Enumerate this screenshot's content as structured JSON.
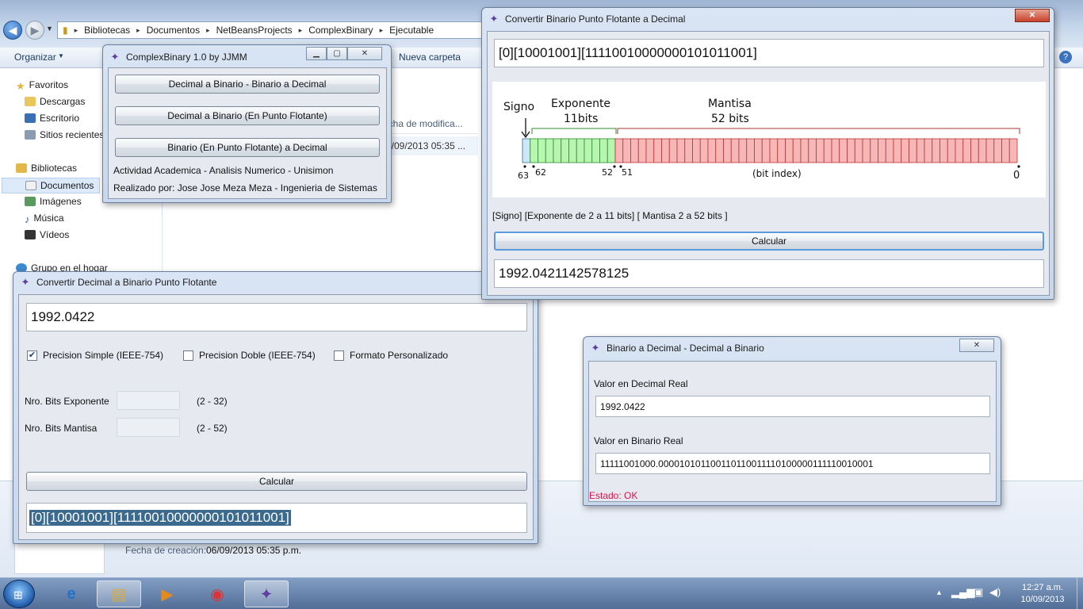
{
  "explorer": {
    "breadcrumb": [
      "Bibliotecas",
      "Documentos",
      "NetBeansProjects",
      "ComplexBinary",
      "Ejecutable"
    ],
    "cmd_organize": "Organizar",
    "cmd_new_folder": "Nueva carpeta",
    "nav": {
      "favoritos": "Favoritos",
      "descargas": "Descargas",
      "escritorio": "Escritorio",
      "sitios": "Sitios recientes",
      "bibliotecas": "Bibliotecas",
      "documentos": "Documentos",
      "imagenes": "Imágenes",
      "musica": "Música",
      "videos": "Vídeos",
      "grupo": "Grupo en el hogar"
    },
    "col_date": "echa de modifica...",
    "row_date": "6/09/2013 05:35 ...",
    "details_label": "Fecha de creación:",
    "details_value": "06/09/2013 05:35 p.m."
  },
  "menu_win": {
    "title": "ComplexBinary 1.0 by JJMM",
    "btn1": "Decimal a Binario - Binario a Decimal",
    "btn2": "Decimal a Binario (En Punto Flotante)",
    "btn3": "Binario (En Punto Flotante)  a Decimal",
    "line1": "Actividad Academica - Analisis Numerico - Unisimon",
    "line2": "Realizado por: Jose Jose Meza Meza - Ingenieria de Sistemas"
  },
  "float_to_dec": {
    "title": "Convertir Binario Punto Flotante a Decimal",
    "input": "[0][10001001][11110010000000101011001]",
    "diagram": {
      "signo": "Signo",
      "exponente": "Exponente",
      "exp_bits": "11bits",
      "mantisa": "Mantisa",
      "man_bits": "52 bits",
      "idx63": "63",
      "idx62": "62",
      "idx52": "52",
      "idx51": "51",
      "idx0": "0",
      "bit_index": "(bit index)"
    },
    "hint": "[Signo]  [Exponente de 2 a 11 bits]  [  Mantisa 2  a 52 bits  ]",
    "calc": "Calcular",
    "output": "1992.0421142578125"
  },
  "dec_to_float": {
    "title": "Convertir Decimal a Binario Punto Flotante",
    "input": "1992.0422",
    "opt_simple": "Precision Simple (IEEE-754)",
    "opt_doble": "Precision Doble (IEEE-754)",
    "opt_custom": "Formato Personalizado",
    "exp_label": "Nro. Bits Exponente",
    "exp_range": "(2 - 32)",
    "man_label": "Nro. Bits Mantisa",
    "man_range": "(2 - 52)",
    "calc": "Calcular",
    "output": "[0][10001001][11110010000000101011001]"
  },
  "bin_dec": {
    "title": "Binario a Decimal - Decimal a Binario",
    "dec_label": "Valor en Decimal Real",
    "dec_value": "1992.0422",
    "bin_label": "Valor en Binario Real",
    "bin_value": "11111001000.00001010110011011001111010000011111001000​1",
    "status": "Estado: OK"
  },
  "taskbar": {
    "time": "12:27 a.m.",
    "date": "10/09/2013"
  },
  "colors": {
    "status_ok": "#e0114b",
    "selection_bg": "#3c6a8f",
    "exponent_fill": "#b8f5b0",
    "mantissa_fill": "#f7b7b7",
    "sign_fill": "#cde7f6"
  }
}
